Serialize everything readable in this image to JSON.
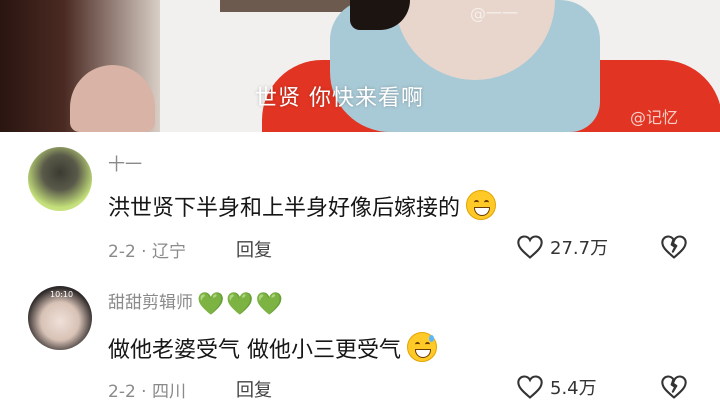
{
  "video": {
    "subtitle": "世贤 你快来看啊",
    "watermark_top": "@一一",
    "watermark_bottom": "@记忆"
  },
  "comments": [
    {
      "username": "十一",
      "text": "洪世贤下半身和上半身好像后嫁接的",
      "emoji": "grinning-smile-emoji",
      "date_location": "2-2 · 辽宁",
      "reply_label": "回复",
      "likes": "27.7万"
    },
    {
      "username": "甜甜剪辑师",
      "username_suffix": "💚💚💚",
      "avatar_time": "10:10",
      "text": "做他老婆受气 做他小三更受气",
      "emoji": "grinning-sweat-emoji",
      "date_location": "2-2 · 四川",
      "reply_label": "回复",
      "likes": "5.4万"
    }
  ],
  "colors": {
    "accent_red": "#e23422",
    "hearts_green": "#1fc24a",
    "meta_gray": "#8a8a8a"
  }
}
